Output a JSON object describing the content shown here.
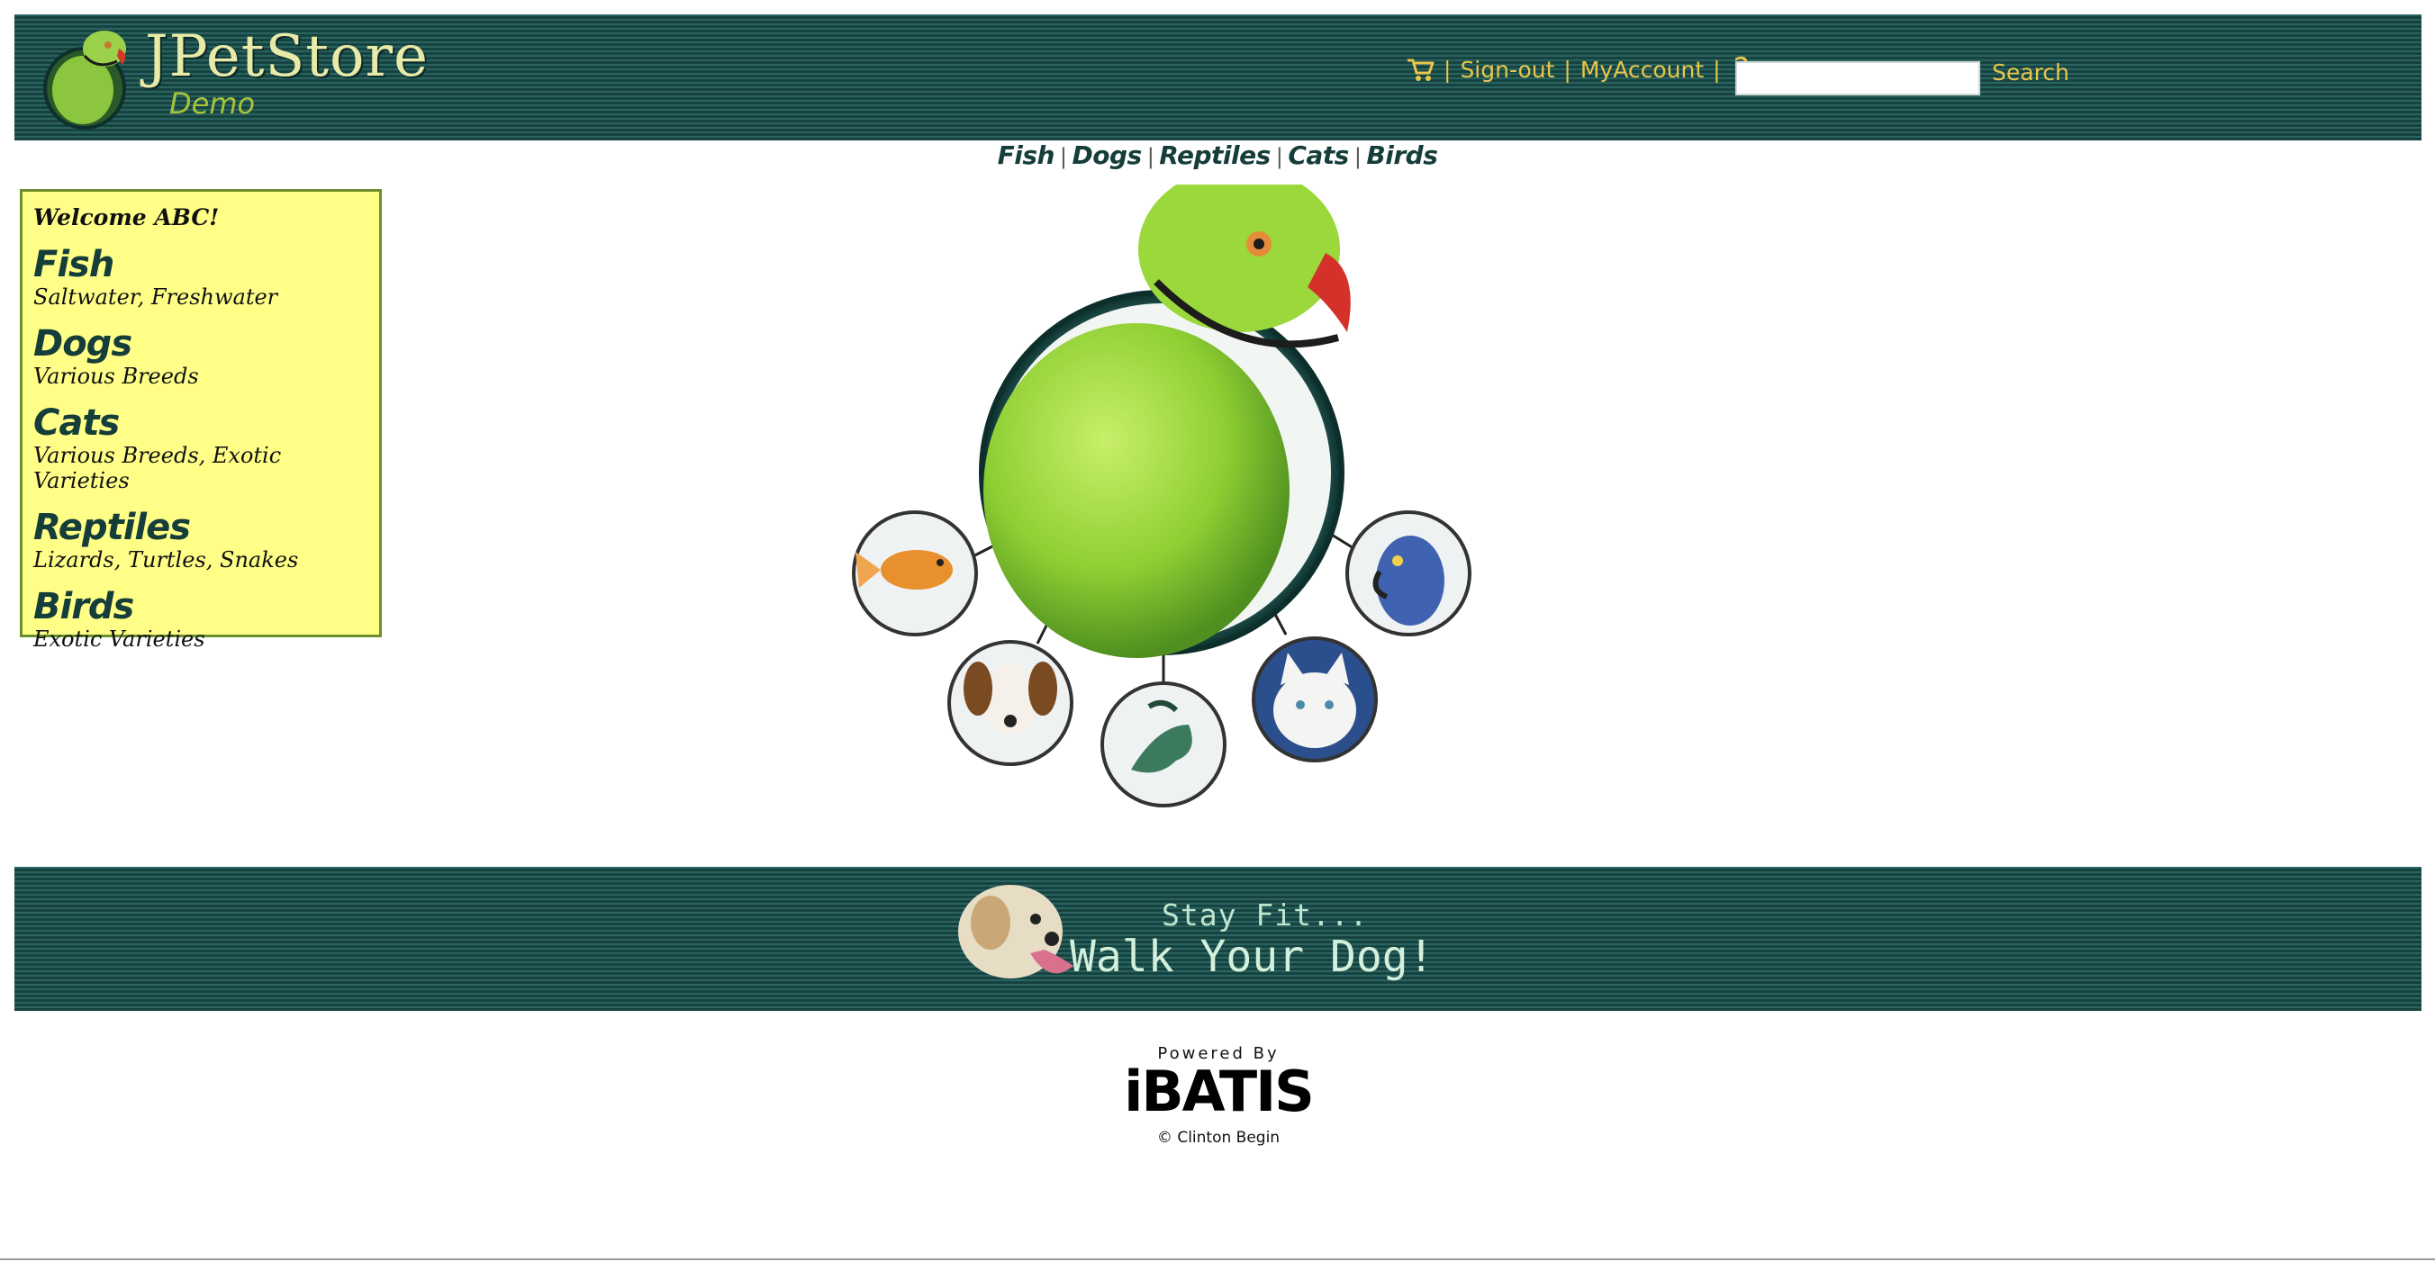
{
  "header": {
    "logo_title": "JPetStore",
    "logo_subtitle": "Demo",
    "menu": {
      "cart_icon": "cart-icon",
      "sign_out": "Sign-out",
      "my_account": "MyAccount",
      "help": "?"
    },
    "search": {
      "value": "",
      "placeholder": "",
      "button_label": "Search"
    }
  },
  "quick_links": [
    "Fish",
    "Dogs",
    "Reptiles",
    "Cats",
    "Birds"
  ],
  "sidebar": {
    "welcome": "Welcome ABC!",
    "categories": [
      {
        "name": "Fish",
        "desc": "Saltwater, Freshwater"
      },
      {
        "name": "Dogs",
        "desc": "Various Breeds"
      },
      {
        "name": "Cats",
        "desc": "Various Breeds, Exotic Varieties"
      },
      {
        "name": "Reptiles",
        "desc": "Lizards, Turtles, Snakes"
      },
      {
        "name": "Birds",
        "desc": "Exotic Varieties"
      }
    ]
  },
  "banner": {
    "line1": "Stay Fit...",
    "line2": "Walk Your Dog!"
  },
  "footer": {
    "powered_by": "Powered By",
    "brand": "iBATIS",
    "copyright": "© Clinton Begin"
  },
  "colors": {
    "header_bg": "#1f4f4c",
    "link_yellow": "#e8c64a",
    "sidebar_bg": "#ffff88",
    "sidebar_border": "#6b8f2c"
  }
}
